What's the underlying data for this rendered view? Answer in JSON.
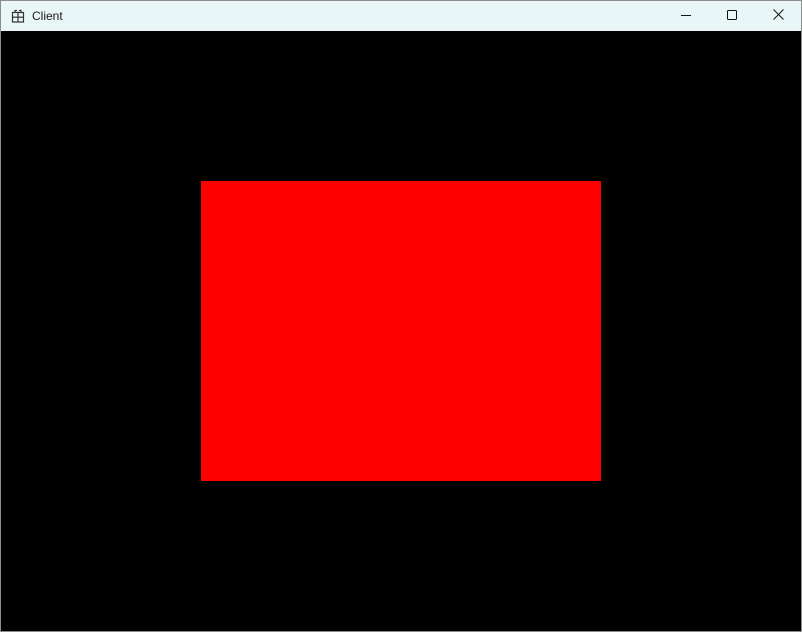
{
  "window": {
    "title": "Client",
    "icons": {
      "app": "app-grid-icon",
      "minimize": "minimize-icon",
      "maximize": "maximize-icon",
      "close": "close-icon"
    }
  },
  "canvas": {
    "background_color": "#000000",
    "shapes": [
      {
        "type": "rectangle",
        "color": "#ff0000"
      }
    ]
  }
}
